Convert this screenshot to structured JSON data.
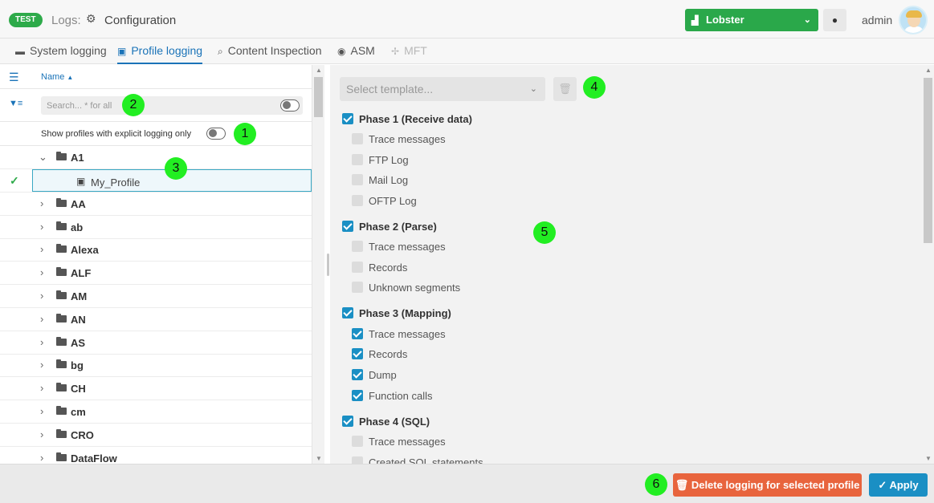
{
  "header": {
    "env_badge": "TEST",
    "breadcrumb_logs": "Logs:",
    "breadcrumb_page": "Configuration",
    "instance": "Lobster",
    "user": "admin"
  },
  "tabs": [
    {
      "label": "System logging",
      "icon": "server-icon"
    },
    {
      "label": "Profile logging",
      "icon": "chip-icon",
      "active": true
    },
    {
      "label": "Content Inspection",
      "icon": "search-plus-icon"
    },
    {
      "label": "ASM",
      "icon": "globe-icon"
    },
    {
      "label": "MFT",
      "icon": "mft-icon",
      "disabled": true
    }
  ],
  "tree": {
    "column": "Name",
    "search_placeholder": "Search... * for all",
    "explicit_toggle_label": "Show profiles with explicit logging only",
    "expanded_folder": "A1",
    "selected_profile": "My_Profile",
    "folders": [
      "AA",
      "ab",
      "Alexa",
      "ALF",
      "AM",
      "AN",
      "AS",
      "bg",
      "CH",
      "cm",
      "CRO",
      "DataFlow"
    ]
  },
  "settings": {
    "template_placeholder": "Select template...",
    "phases": [
      {
        "label": "Phase 1 (Receive data)",
        "checked": true,
        "items": [
          {
            "label": "Trace messages",
            "checked": false
          },
          {
            "label": "FTP Log",
            "checked": false
          },
          {
            "label": "Mail Log",
            "checked": false
          },
          {
            "label": "OFTP Log",
            "checked": false
          }
        ]
      },
      {
        "label": "Phase 2 (Parse)",
        "checked": true,
        "items": [
          {
            "label": "Trace messages",
            "checked": false
          },
          {
            "label": "Records",
            "checked": false
          },
          {
            "label": "Unknown segments",
            "checked": false
          }
        ]
      },
      {
        "label": "Phase 3 (Mapping)",
        "checked": true,
        "items": [
          {
            "label": "Trace messages",
            "checked": true
          },
          {
            "label": "Records",
            "checked": true
          },
          {
            "label": "Dump",
            "checked": true
          },
          {
            "label": "Function calls",
            "checked": true
          }
        ]
      },
      {
        "label": "Phase 4 (SQL)",
        "checked": true,
        "items": [
          {
            "label": "Trace messages",
            "checked": false
          },
          {
            "label": "Created SQL statements",
            "checked": false
          }
        ]
      }
    ]
  },
  "footer": {
    "delete_label": "Delete logging for selected profile",
    "apply_label": "Apply"
  },
  "markers": [
    "1",
    "2",
    "3",
    "4",
    "5",
    "6"
  ],
  "colors": {
    "accent": "#1a8fc4",
    "env_badge": "#2eaa4a",
    "instance": "#2aa84a",
    "delete": "#e8643d",
    "marker": "#22ee22"
  }
}
